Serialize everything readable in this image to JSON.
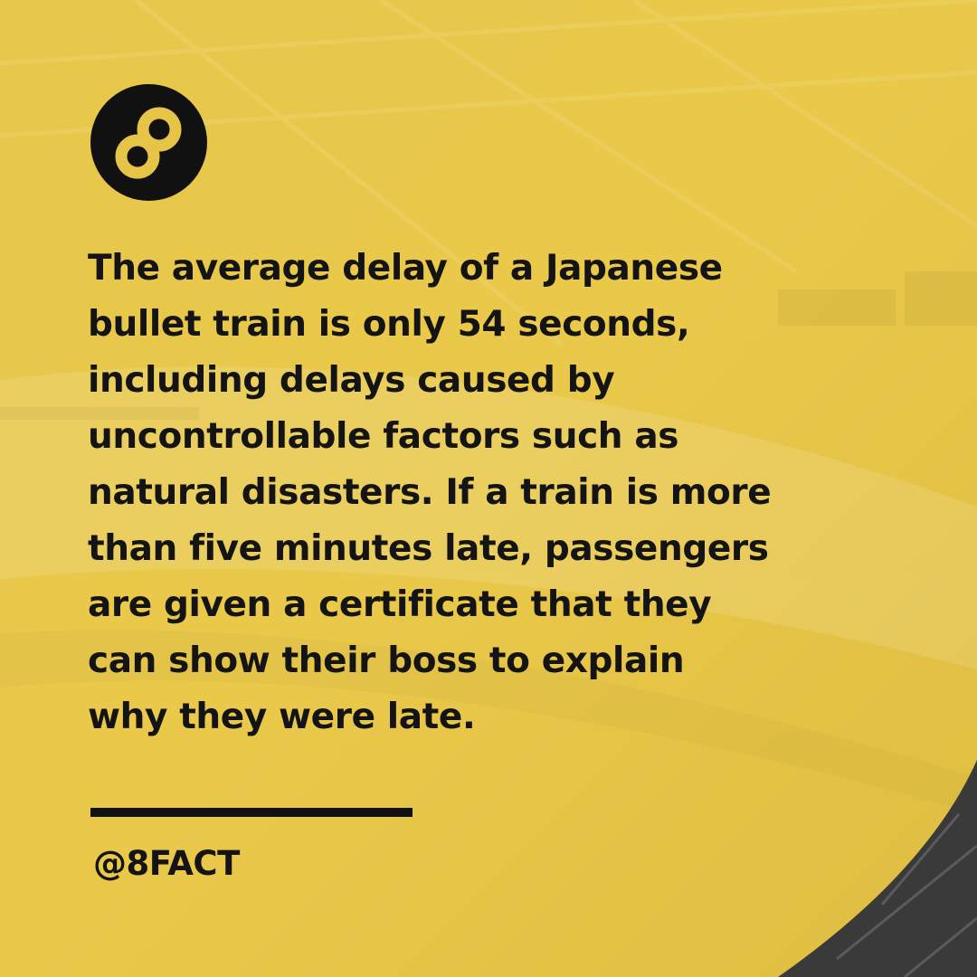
{
  "post": {
    "fact_text": "The average delay of a Japanese\nbullet train is only 54 seconds,\nincluding delays caused by\nuncontrollable factors such as\nnatural disasters. If a train is more\nthan five minutes late, passengers\nare given a certificate that they\ncan show their boss to explain\nwhy they were late.",
    "handle": "@8FACT"
  },
  "brand": {
    "logo_icon": "infinity-eight-icon"
  },
  "colors": {
    "background_yellow": "#e6c447",
    "ink": "#111111",
    "corner_dark": "#3a3a3a"
  }
}
